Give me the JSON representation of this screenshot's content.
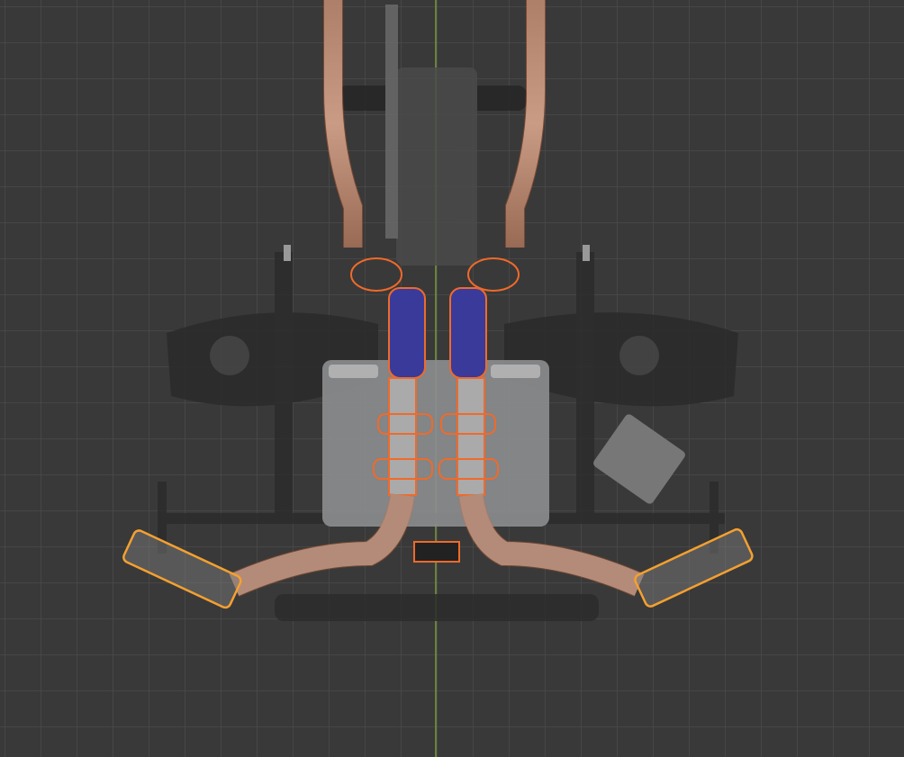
{
  "viewport": {
    "mode": "3d-viewport",
    "colors": {
      "background": "#393939",
      "grid": "#4b4b4b",
      "y_axis": "#7a9a3a",
      "selection_outline": "#f06a2a",
      "active_outline": "#f5a030",
      "blue_parts": "#3a3a9a"
    }
  }
}
